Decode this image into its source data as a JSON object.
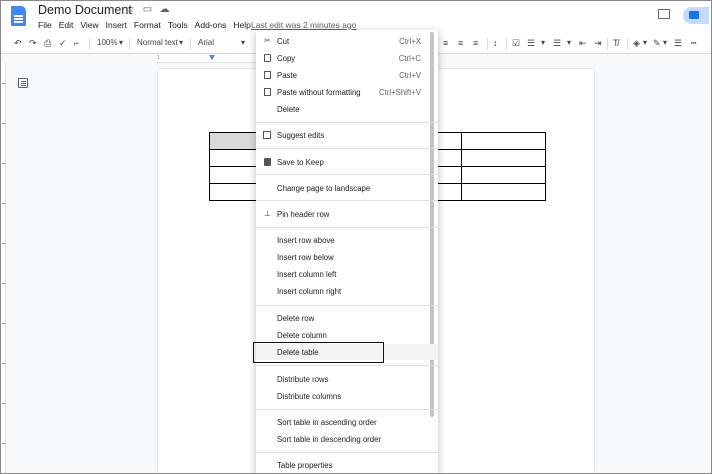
{
  "app": {
    "title": "Demo Document",
    "last_edit": "Last edit was 2 minutes ago",
    "menu": [
      "File",
      "Edit",
      "View",
      "Insert",
      "Format",
      "Tools",
      "Add-ons",
      "Help"
    ]
  },
  "toolbar": {
    "zoom": "100%",
    "style": "Normal text",
    "font": "Arial"
  },
  "ruler": {
    "mark": "1"
  },
  "context_menu": {
    "items": [
      {
        "label": "Cut",
        "shortcut": "Ctrl+X",
        "icon": "scissors-icon"
      },
      {
        "label": "Copy",
        "shortcut": "Ctrl+C",
        "icon": "copy-icon"
      },
      {
        "label": "Paste",
        "shortcut": "Ctrl+V",
        "icon": "paste-icon"
      },
      {
        "label": "Paste without formatting",
        "shortcut": "Ctrl+Shift+V",
        "icon": "paste-plain-icon"
      },
      {
        "label": "Delete",
        "shortcut": ""
      },
      {
        "label": "Suggest edits",
        "shortcut": "",
        "icon": "suggest-edits-icon"
      },
      {
        "label": "Save to Keep",
        "shortcut": "",
        "icon": "keep-icon"
      },
      {
        "label": "Change page to landscape",
        "shortcut": ""
      },
      {
        "label": "Pin header row",
        "shortcut": "",
        "icon": "pin-icon"
      },
      {
        "label": "Insert row above",
        "shortcut": ""
      },
      {
        "label": "Insert row below",
        "shortcut": ""
      },
      {
        "label": "Insert column left",
        "shortcut": ""
      },
      {
        "label": "Insert column right",
        "shortcut": ""
      },
      {
        "label": "Delete row",
        "shortcut": ""
      },
      {
        "label": "Delete column",
        "shortcut": ""
      },
      {
        "label": "Delete table",
        "shortcut": ""
      },
      {
        "label": "Distribute rows",
        "shortcut": ""
      },
      {
        "label": "Distribute columns",
        "shortcut": ""
      },
      {
        "label": "Sort table in ascending order",
        "shortcut": ""
      },
      {
        "label": "Sort table in descending order",
        "shortcut": ""
      },
      {
        "label": "Table properties",
        "shortcut": ""
      }
    ]
  }
}
